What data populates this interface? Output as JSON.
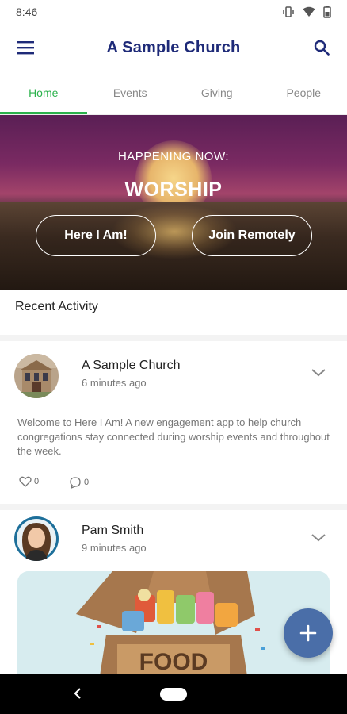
{
  "status_bar": {
    "time": "8:46"
  },
  "app_bar": {
    "title": "A Sample Church"
  },
  "tabs": [
    {
      "label": "Home",
      "active": true
    },
    {
      "label": "Events",
      "active": false
    },
    {
      "label": "Giving",
      "active": false
    },
    {
      "label": "People",
      "active": false
    }
  ],
  "hero": {
    "kicker": "HAPPENING NOW:",
    "title": "WORSHIP",
    "primary_button": "Here I Am!",
    "secondary_button": "Join Remotely"
  },
  "recent_activity": {
    "title": "Recent Activity",
    "posts": [
      {
        "author": "A Sample Church",
        "time": "6 minutes ago",
        "body": "Welcome to Here I Am! A new engagement app to help church congregations stay connected during worship events and throughout the week.",
        "likes": "0",
        "comments": "0"
      },
      {
        "author": "Pam Smith",
        "time": "9 minutes ago",
        "image_text": "FOOD"
      }
    ]
  },
  "colors": {
    "accent": "#2bb24c",
    "title": "#1e2a78",
    "fab": "#4a6ea8"
  }
}
